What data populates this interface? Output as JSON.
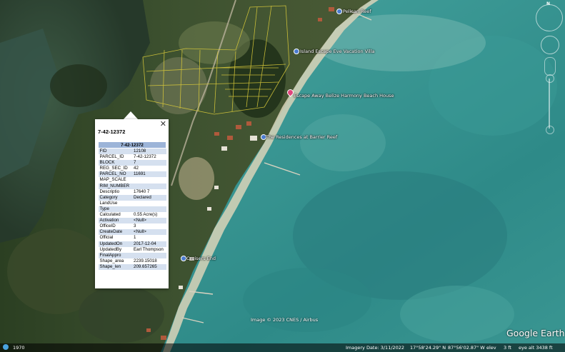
{
  "map": {
    "labels": {
      "place_top": "Pelican Reef",
      "vacation_villa": "Island Escape Eve Vacation Villa",
      "escape_away": "Escape Away Belize Harmony Beach House",
      "residences": "The Residences at Barrier Reef",
      "cruisers_end": "Cruisers End"
    },
    "credit": "Image © 2023 CNES / Airbus",
    "brand": "Google Earth",
    "compass_letter": "N"
  },
  "popup": {
    "title": "7-42-12372",
    "close_symbol": "✕",
    "table_header": "7-42-12372",
    "rows": [
      {
        "key": "FID",
        "value": "12108"
      },
      {
        "key": "PARCEL_ID",
        "value": "7-42-12372"
      },
      {
        "key": "BLOCK",
        "value": "7"
      },
      {
        "key": "REG_SEC_ID",
        "value": "42"
      },
      {
        "key": "PARCEL_NO",
        "value": "11691"
      },
      {
        "key": "MAP_SCALE",
        "value": ""
      },
      {
        "key": "RIM_NUMBER",
        "value": ""
      },
      {
        "key": "Descriptio",
        "value": "17640 7"
      },
      {
        "key": "Category",
        "value": "Declared"
      },
      {
        "key": "LandUse",
        "value": ""
      },
      {
        "key": "Type",
        "value": ""
      },
      {
        "key": "Calculated",
        "value": "0.55 Acre(s)"
      },
      {
        "key": "Activation",
        "value": "<Null>"
      },
      {
        "key": "OfficeID",
        "value": "3"
      },
      {
        "key": "CreateDate",
        "value": "<Null>"
      },
      {
        "key": "Official",
        "value": "1"
      },
      {
        "key": "UpdatedOn",
        "value": "2017-12-04"
      },
      {
        "key": "UpdatedBy",
        "value": "Earl Thompson"
      },
      {
        "key": "FinalAppro",
        "value": ""
      },
      {
        "key": "Shape_area",
        "value": "2239.15018"
      },
      {
        "key": "Shape_len",
        "value": "209.657265"
      }
    ]
  },
  "status_bar": {
    "year": "1970",
    "imagery_date": "Imagery Date: 3/11/2022",
    "lat": "17°58'24.29\" N",
    "lon": "87°56'02.87\" W",
    "elev_label": "elev",
    "elev_value": "3 ft",
    "eye_alt": "eye alt  3438 ft"
  },
  "colors": {
    "popup_header": "#9cb4d8",
    "popup_row_alt": "#d5e0ef",
    "parcel_lines": "#d8c93a",
    "sea": "#2f8f8c"
  }
}
